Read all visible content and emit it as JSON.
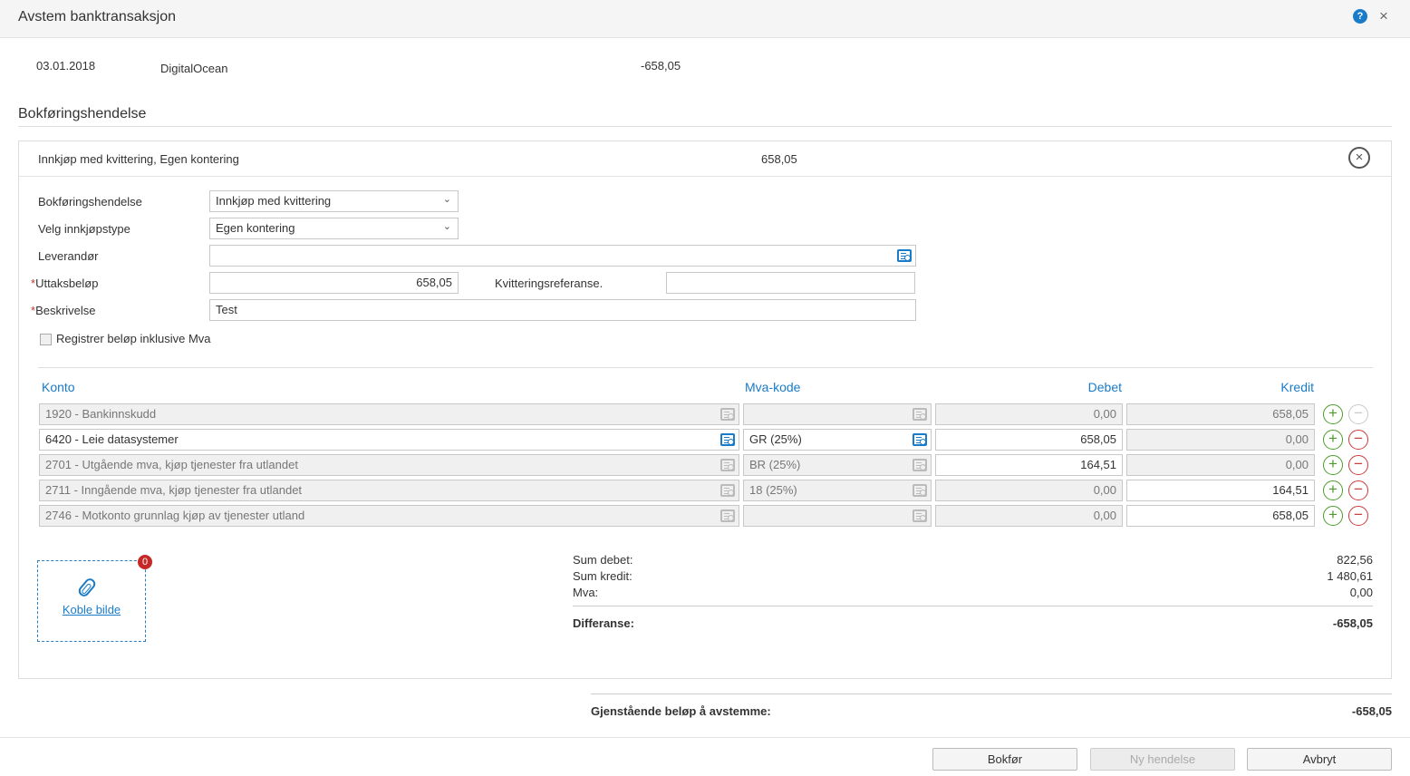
{
  "window": {
    "title": "Avstem banktransaksjon",
    "help_label": "?",
    "close_label": "×"
  },
  "transaction": {
    "date": "03.01.2018",
    "name": "DigitalOcean",
    "amount": "-658,05"
  },
  "section": {
    "title": "Bokføringshendelse"
  },
  "event": {
    "summary": "Innkjøp med kvittering, Egen kontering",
    "amount": "658,05",
    "remove_label": "×"
  },
  "form": {
    "event_type_label": "Bokføringshendelse",
    "event_type_value": "Innkjøp med kvittering",
    "purchase_type_label": "Velg innkjøpstype",
    "purchase_type_value": "Egen kontering",
    "supplier_label": "Leverandør",
    "supplier_value": "",
    "required_mark": "*",
    "amount_label": "Uttaksbeløp",
    "amount_value": "658,05",
    "receipt_ref_label": "Kvitteringsreferanse.",
    "receipt_ref_value": "",
    "description_label": "Beskrivelse",
    "description_value": "Test",
    "include_vat_label": "Registrer beløp inklusive Mva",
    "include_vat_checked": false
  },
  "grid": {
    "headers": {
      "account": "Konto",
      "vat_code": "Mva-kode",
      "debit": "Debet",
      "credit": "Kredit"
    },
    "rows": [
      {
        "account": "1920 - Bankinnskudd",
        "vat_code": "",
        "debit": "0,00",
        "credit": "658,05"
      },
      {
        "account": "6420 - Leie datasystemer",
        "vat_code": "GR (25%)",
        "debit": "658,05",
        "credit": "0,00"
      },
      {
        "account": "2701 - Utgående mva, kjøp tjenester fra utlandet",
        "vat_code": "BR (25%)",
        "debit": "164,51",
        "credit": "0,00"
      },
      {
        "account": "2711 - Inngående mva, kjøp tjenester fra utlandet",
        "vat_code": "18 (25%)",
        "debit": "0,00",
        "credit": "164,51"
      },
      {
        "account": "2746 - Motkonto grunnlag kjøp av tjenester utland",
        "vat_code": "",
        "debit": "0,00",
        "credit": "658,05"
      }
    ],
    "add_label": "+",
    "remove_label": "−"
  },
  "attachment": {
    "link_label": "Koble bilde",
    "count": "0"
  },
  "summary": {
    "sum_debit_label": "Sum debet:",
    "sum_debit_value": "822,56",
    "sum_credit_label": "Sum kredit:",
    "sum_credit_value": "1 480,61",
    "vat_label": "Mva:",
    "vat_value": "0,00",
    "difference_label": "Differanse:",
    "difference_value": "-658,05"
  },
  "remaining": {
    "label": "Gjenstående beløp å avstemme:",
    "value": "-658,05"
  },
  "buttons": {
    "post": "Bokfør",
    "new_event": "Ny hendelse",
    "cancel": "Avbryt"
  }
}
